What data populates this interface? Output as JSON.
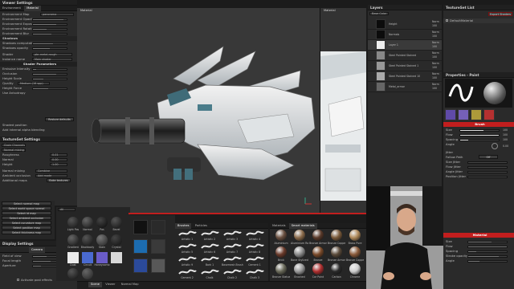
{
  "colors": {
    "accent": "#c21e1e",
    "panel": "#2a2a2a",
    "header": "#202020",
    "viewport": "#353535"
  },
  "viewer": {
    "header": "Viewer Settings",
    "tabs": [
      "Environment",
      "Material"
    ],
    "rows": [
      "Environment Map",
      "Environment Opacity",
      "Environment Exposure",
      "Environment Rotation",
      "Environment Blur"
    ],
    "env_map_value": "panorama",
    "section_shadows": "Shadows",
    "shadow_rows": [
      "Shadows computation",
      "Shadows opacity"
    ],
    "shader_label": "Shader",
    "shader_value": "pbr-metal-rough",
    "instance_label": "Instance name",
    "instance_value": "Main shader",
    "shader_params": "Shader Parameters",
    "param_rows": [
      "Emissive Intensity",
      "Occlusion",
      "Height Scale",
      "Quality",
      "Height Force",
      "Use Anisotropy"
    ],
    "quality_value": "Medium (16 spp)",
    "restore_btn": "Restore defaults",
    "normal_rows": [
      "Shaded position",
      "Ambient Occlusion",
      "Alpha blending",
      "Add internal alpha blending"
    ]
  },
  "texset_settings": {
    "header": "TextureSet Settings",
    "rows": [
      "Grain Channels",
      "Normal mixing",
      "Roughness",
      "Normal",
      "Height",
      "Normal mixing",
      "Ambient occlusion",
      "Additional maps"
    ],
    "btn": "Bake textures",
    "values": [
      "0.01",
      "0.00",
      "1.00"
    ],
    "normal_mix_value": "Combine",
    "ao_value": "Add mode"
  },
  "viewport3d": {
    "title": "Material"
  },
  "viewport2d": {
    "title": "Material"
  },
  "layers": {
    "header": "Layers",
    "blend": "Base Color",
    "items": [
      {
        "name": "Height",
        "blend": "Norm",
        "opacity": "100"
      },
      {
        "name": "Normals",
        "blend": "Norm",
        "opacity": "100"
      },
      {
        "name": "Layer 1",
        "blend": "Norm",
        "opacity": "100"
      },
      {
        "name": "Steel Painted Stained",
        "blend": "Norm",
        "opacity": "100"
      },
      {
        "name": "Steel Painted Stained 1",
        "blend": "Norm",
        "opacity": "100"
      },
      {
        "name": "Steel Painted Stained 10",
        "blend": "Norm",
        "opacity": "100"
      },
      {
        "name": "Metal_armor",
        "blend": "Norm",
        "opacity": "100"
      }
    ]
  },
  "texset_list": {
    "header": "TextureSet List",
    "btn": "Export Shaders",
    "item": "DefaultMaterial"
  },
  "properties": {
    "header": "Properties - Paint",
    "brush_section": "Brush",
    "rows": [
      "Size",
      "Flow",
      "Spacing",
      "Angle",
      "Jitter",
      "Follow Path",
      "Size Jitter",
      "Flow Jitter",
      "Angle Jitter",
      "Position Jitter",
      "Material"
    ],
    "values": [
      "100",
      "100",
      "100",
      "0.00",
      "Off"
    ],
    "bottom_rows": [
      "Size",
      "Flow",
      "Spacing",
      "Stroke opacity",
      "Angle"
    ]
  },
  "shelf_left": {
    "buttons": [
      "Select normal map",
      "Select world space normal",
      "Select id map",
      "Select ambient occlusion",
      "Select curvature map",
      "Select position map",
      "Select thickness map"
    ],
    "search": "All",
    "items": [
      "Light Pos",
      "Normal",
      "Pos",
      "Bevel",
      "Gradient",
      "Blackbody",
      "Stain",
      "Crystal",
      "Dust",
      "Circuit",
      "Honeycomb"
    ]
  },
  "shelf_brushes": {
    "tabs": [
      "Brushes",
      "Particles"
    ],
    "items": [
      "Artistic 1",
      "Artistic 2",
      "Artistic 3",
      "Artistic 4",
      "Artistic 5",
      "Artistic 6",
      "Artistic 7",
      "Artistic 8",
      "Artistic 9",
      "Bark 1",
      "Basemesh Brush",
      "Cement 1",
      "Cement 2",
      "Chalk",
      "Chalk 2",
      "Chalk 3",
      "Charcoal",
      "Charcoal 2"
    ]
  },
  "shelf_materials": {
    "tabs": [
      "Materials",
      "Smart materials"
    ],
    "items": [
      "Aluminium",
      "Aluminium Roug",
      "Bronze Armor",
      "Bronze Copper",
      "Brass Pure",
      "Brick",
      "Bone Stylized",
      "Bronze",
      "Bronze Armor",
      "Bronze Copper",
      "Bronze Statue",
      "Brushed",
      "Car Paint",
      "Carbon",
      "Chrome"
    ]
  },
  "display": {
    "header": "Display Settings",
    "tab": "Camera",
    "rows": [
      "Field of view",
      "Focal length",
      "Aperture"
    ],
    "check": "Activate post effects",
    "status": [
      "Scene",
      "Viewer",
      "Normal Map"
    ]
  }
}
